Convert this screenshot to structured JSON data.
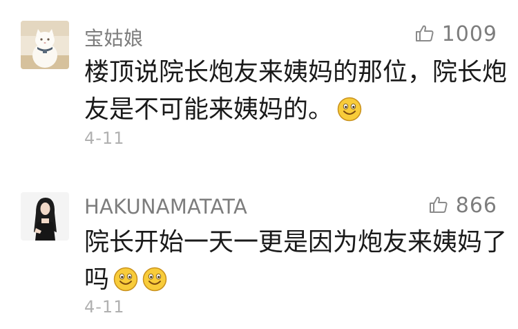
{
  "comments": [
    {
      "username": "宝姑娘",
      "likes": "1009",
      "text_line1": "楼顶说院长炮友来姨妈的那位，院长炮",
      "text_line2": "友是不可能来姨妈的。",
      "emoji_count": 1,
      "date": "4-11"
    },
    {
      "username": "HAKUNAMATATA",
      "likes": "866",
      "text_line1": "院长开始一天一更是因为炮友来姨妈了",
      "text_line2": "吗",
      "emoji_count": 2,
      "date": "4-11"
    }
  ],
  "icons": {
    "like": "thumbs-up-icon",
    "emoji": "smiling-face-icon"
  },
  "colors": {
    "username": "#7d7d7d",
    "text": "#1a1a1a",
    "date": "#b0b0b0",
    "emoji": "#f6c531"
  }
}
